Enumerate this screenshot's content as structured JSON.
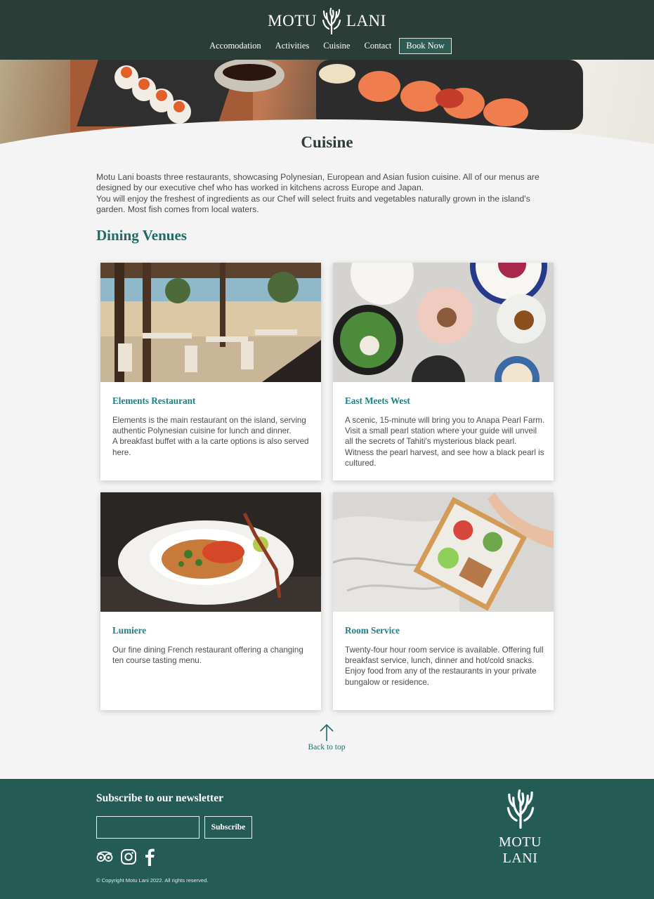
{
  "header": {
    "logo_left": "MOTU",
    "logo_right": "LANI",
    "nav": [
      "Accomodation",
      "Activities",
      "Cuisine",
      "Contact"
    ],
    "book_label": "Book Now"
  },
  "main": {
    "title": "Cuisine",
    "intro": [
      "Motu Lani boasts three restaurants, showcasing Polynesian, European and Asian fusion cuisine. All of our menus are designed by our executive chef who has worked in kitchens across Europe and Japan.",
      "You will enjoy the freshest of ingredients as our Chef will select fruits and vegetables naturally grown in the island's garden. Most fish comes from local waters."
    ],
    "venues_heading": "Dining Venues",
    "venues": [
      {
        "title": "Elements Restaurant",
        "description": "Elements is the main restaurant on the island, serving authentic Polynesian cuisine for lunch and dinner.\nA breakfast buffet with a la carte options is also served here."
      },
      {
        "title": "East Meets West",
        "description": "A scenic, 15-minute will bring you to Anapa Pearl Farm. Visit a small pearl station where your guide will unveil all the secrets of Tahiti's mysterious black pearl. Witness the pearl harvest, and see how a black pearl is cultured."
      },
      {
        "title": "Lumiere",
        "description": "Our fine dining French restaurant offering a changing ten course tasting menu."
      },
      {
        "title": "Room Service",
        "description": "Twenty-four hour room service is available. Offering full breakfast service, lunch, dinner and hot/cold snacks. Enjoy food from any of the restaurants in your private bungalow or residence."
      }
    ],
    "back_to_top": "Back to top"
  },
  "footer": {
    "newsletter_heading": "Subscribe to our newsletter",
    "email_value": "",
    "subscribe_label": "Subscribe",
    "socials": [
      "tripadvisor-icon",
      "instagram-icon",
      "facebook-icon"
    ],
    "copyright": "© Copyright Motu Lani 2022. All rights reserved.",
    "logo_text": "MOTU LANI"
  },
  "colors": {
    "header_bg": "#2b3d37",
    "footer_bg": "#245c55",
    "accent_teal": "#1f6c64",
    "card_title": "#1f7f86",
    "page_bg": "#f4f4f4"
  }
}
